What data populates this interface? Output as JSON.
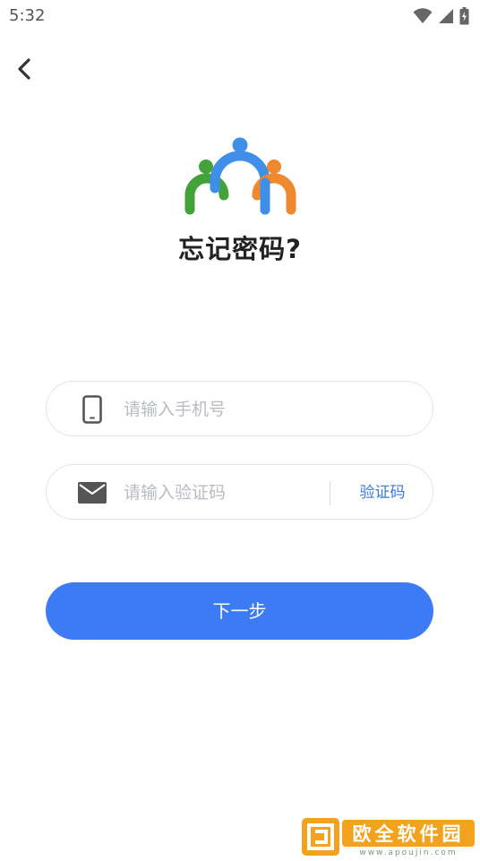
{
  "status_bar": {
    "time": "5:32",
    "icons": [
      "wifi-icon",
      "cell-signal-icon",
      "battery-icon"
    ]
  },
  "header": {
    "back_icon": "chevron-left-icon"
  },
  "logo": {
    "colors": [
      "#43a33a",
      "#3f8fe8",
      "#f0882f"
    ]
  },
  "page": {
    "title": "忘记密码?"
  },
  "form": {
    "phone": {
      "icon": "phone-icon",
      "value": "",
      "placeholder": "请输入手机号"
    },
    "code": {
      "icon": "mail-icon",
      "value": "",
      "placeholder": "请输入验证码",
      "get_code_label": "验证码"
    },
    "next_label": "下一步"
  },
  "watermark": {
    "text": "欧全软件园",
    "url": "www.apoujin.com"
  },
  "colors": {
    "primary": "#3d7bf5",
    "link": "#3a78e0",
    "placeholder": "#b8bcc2",
    "border": "#e2e4e8"
  }
}
